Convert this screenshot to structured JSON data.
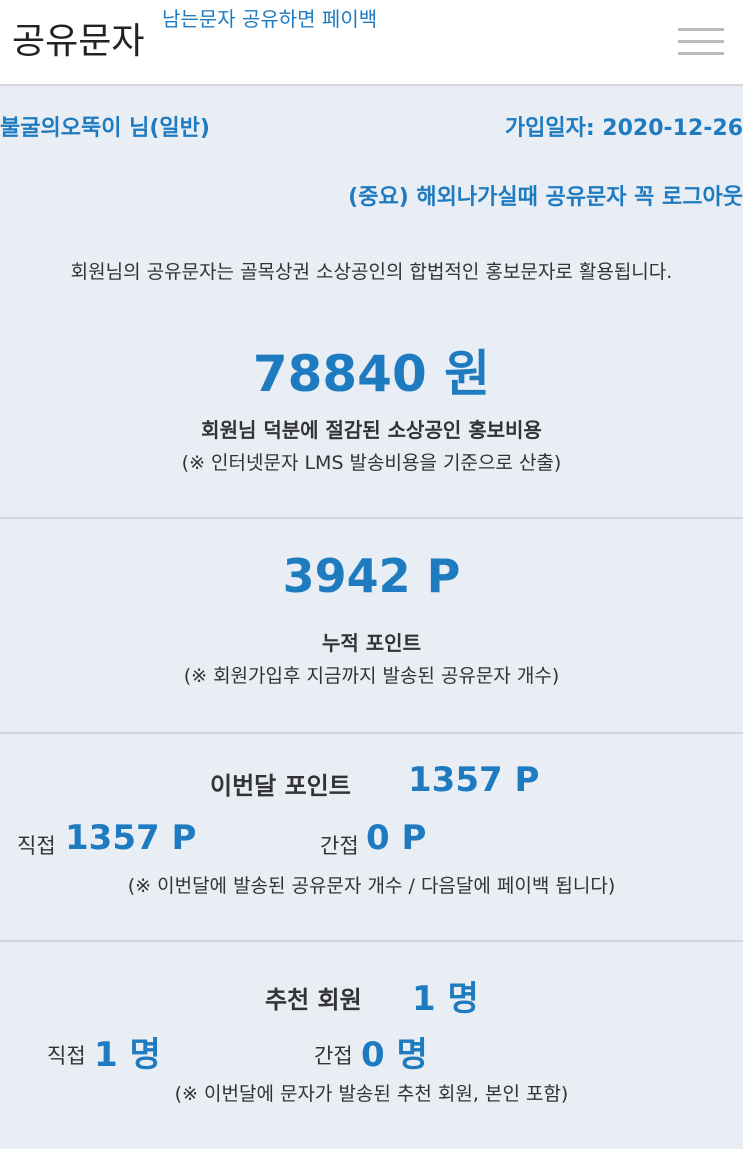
{
  "header": {
    "brand": "공유문자",
    "tagline": "남는문자 공유하면 페이백",
    "menu_icon": "hamburger-menu-icon"
  },
  "account": {
    "user": "불굴의오뚝이 님(일반)",
    "join_date": "가입일자: 2020-12-26",
    "logout_notice": "(중요) 해외나가실때 공유문자 꼭 로그아웃"
  },
  "intro": "회원님의 공유문자는 골목상권 소상공인의 합법적인 홍보문자로 활용됩니다.",
  "savings": {
    "amount": "78840 원",
    "caption": "회원님 덕분에 절감된 소상공인 홍보비용",
    "note": "(※ 인터넷문자 LMS 발송비용을 기준으로 산출)"
  },
  "points": {
    "amount": "3942 P",
    "caption": "누적 포인트",
    "note": "(※ 회원가입후 지금까지 발송된 공유문자 개수)"
  },
  "monthly": {
    "label": "이번달 포인트",
    "value": "1357 P",
    "direct_label": "직접",
    "direct_value": "1357 P",
    "indirect_label": "간접",
    "indirect_value": "0 P",
    "note": "(※ 이번달에 발송된 공유문자 개수 / 다음달에 페이백 됩니다)"
  },
  "referral": {
    "label": "추천 회원",
    "value": "1 명",
    "direct_label": "직접",
    "direct_value": "1 명",
    "indirect_label": "간접",
    "indirect_value": "0 명",
    "note": "(※ 이번달에 문자가 발송된 추천 회원, 본인 포함)"
  },
  "colors": {
    "accent": "#1f7bc0",
    "background": "#e9eef5",
    "header_bg": "#ffffff"
  }
}
